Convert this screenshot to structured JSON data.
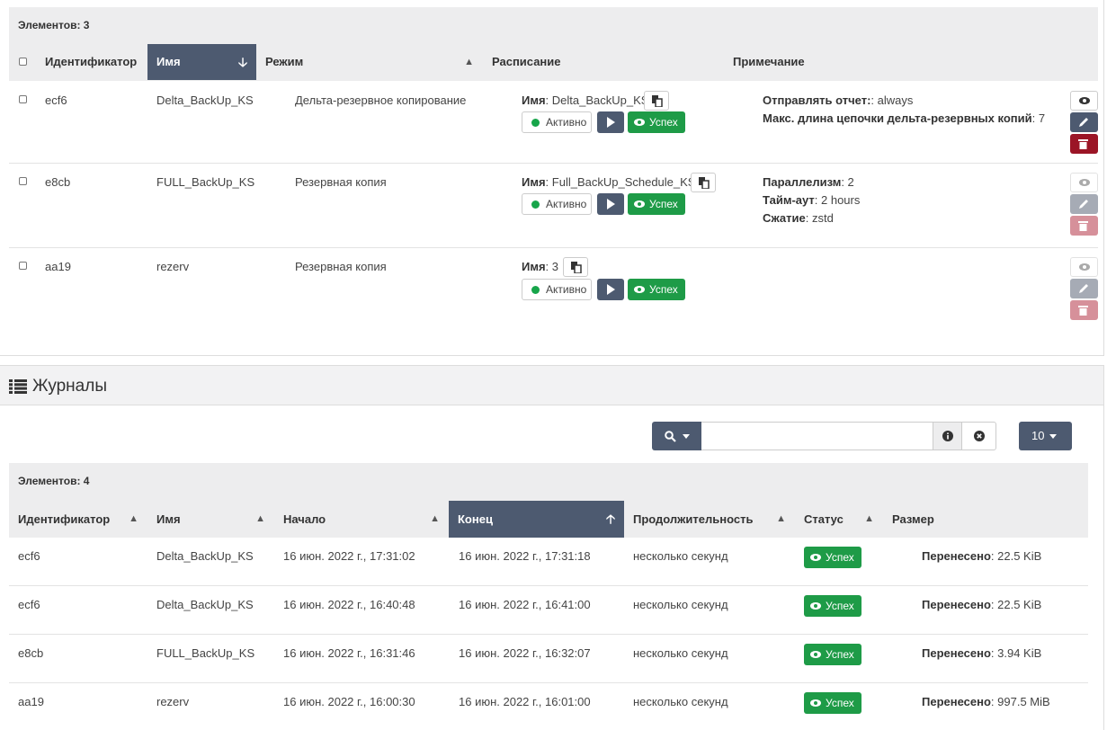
{
  "jobs": {
    "count_label": "Элементов: 3",
    "columns": {
      "id": "Идентификатор",
      "name": "Имя",
      "mode": "Режим",
      "schedule": "Расписание",
      "note": "Примечание"
    },
    "rows": [
      {
        "id": "ecf6",
        "name": "Delta_BackUp_KS",
        "mode": "Дельта-резервное копирование",
        "schedule_label": "Имя",
        "schedule_value": ": Delta_BackUp_KS",
        "active": "Активно",
        "status": "Успех",
        "notes": [
          {
            "label": "Отправлять отчет:",
            "value": ": always"
          },
          {
            "label": "Макс. длина цепочки дельта-резервных копий",
            "value": ": 7"
          }
        ]
      },
      {
        "id": "e8cb",
        "name": "FULL_BackUp_KS",
        "mode": "Резервная копия",
        "schedule_label": "Имя",
        "schedule_value": ": Full_BackUp_Schedule_KS",
        "active": "Активно",
        "status": "Успех",
        "notes": [
          {
            "label": "Параллелизм",
            "value": ": 2"
          },
          {
            "label": "Тайм-аут",
            "value": ": 2 hours"
          },
          {
            "label": "Сжатие",
            "value": ": zstd"
          }
        ]
      },
      {
        "id": "aa19",
        "name": "rezerv",
        "mode": "Резервная копия",
        "schedule_label": "Имя",
        "schedule_value": ": 3",
        "active": "Активно",
        "status": "Успех",
        "notes": []
      }
    ]
  },
  "logs": {
    "title": "Журналы",
    "search": {
      "value": "",
      "placeholder": ""
    },
    "page_size": "10",
    "count_label": "Элементов: 4",
    "columns": {
      "id": "Идентификатор",
      "name": "Имя",
      "start": "Начало",
      "end": "Конец",
      "duration": "Продолжительность",
      "status": "Статус",
      "size": "Размер"
    },
    "rows": [
      {
        "id": "ecf6",
        "name": "Delta_BackUp_KS",
        "start": "16 июн. 2022 г., 17:31:02",
        "end": "16 июн. 2022 г., 17:31:18",
        "duration": "несколько секунд",
        "status": "Успех",
        "size_label": "Перенесено",
        "size_value": ": 22.5 KiB"
      },
      {
        "id": "ecf6",
        "name": "Delta_BackUp_KS",
        "start": "16 июн. 2022 г., 16:40:48",
        "end": "16 июн. 2022 г., 16:41:00",
        "duration": "несколько секунд",
        "status": "Успех",
        "size_label": "Перенесено",
        "size_value": ": 22.5 KiB"
      },
      {
        "id": "e8cb",
        "name": "FULL_BackUp_KS",
        "start": "16 июн. 2022 г., 16:31:46",
        "end": "16 июн. 2022 г., 16:32:07",
        "duration": "несколько секунд",
        "status": "Успех",
        "size_label": "Перенесено",
        "size_value": ": 3.94 KiB"
      },
      {
        "id": "aa19",
        "name": "rezerv",
        "start": "16 июн. 2022 г., 16:00:30",
        "end": "16 июн. 2022 г., 16:01:00",
        "duration": "несколько секунд",
        "status": "Успех",
        "size_label": "Перенесено",
        "size_value": ": 997.5 MiB"
      }
    ]
  }
}
